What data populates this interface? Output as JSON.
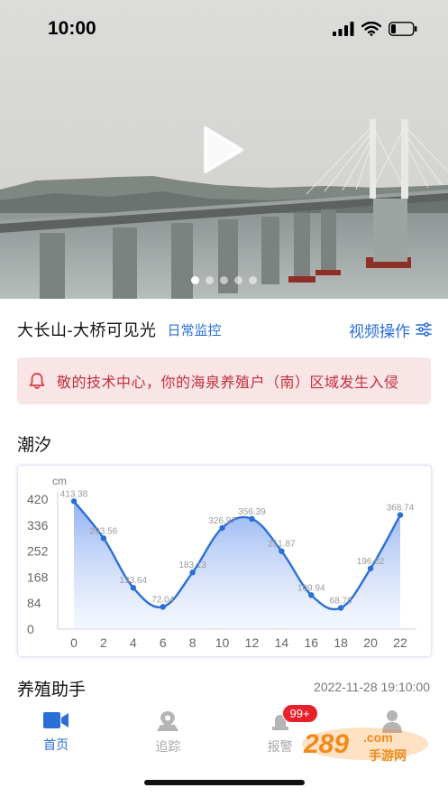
{
  "status": {
    "time": "10:00"
  },
  "hero": {
    "slides": 5,
    "active_slide": 0
  },
  "camera": {
    "title": "大长山-大桥可见光",
    "tag": "日常监控",
    "ops_label": "视频操作"
  },
  "alert": {
    "text": "敬的技术中心，你的海泉养殖户（南）区域发生入侵"
  },
  "tide": {
    "title": "潮汐"
  },
  "assistant": {
    "title": "养殖助手",
    "timestamp": "2022-11-28 19:10:00"
  },
  "tabs": [
    {
      "label": "首页",
      "icon": "video-camera-icon",
      "active": true
    },
    {
      "label": "追踪",
      "icon": "map-pin-icon",
      "active": false
    },
    {
      "label": "报警",
      "icon": "alarm-icon",
      "active": false,
      "badge": "99+"
    },
    {
      "label": "",
      "icon": "person-icon",
      "active": false
    }
  ],
  "watermark": {
    "text": "289 .com 手游网"
  },
  "colors": {
    "accent": "#2a6fd6",
    "alert_bg": "#f9e4e6",
    "alert_text": "#c2303c",
    "badge": "#e8202a"
  },
  "chart_data": {
    "type": "area",
    "title": "",
    "xlabel": "",
    "ylabel": "cm",
    "x": [
      0,
      2,
      4,
      6,
      8,
      10,
      12,
      14,
      16,
      18,
      20,
      22
    ],
    "series": [
      {
        "values": [
          413.38,
          293.56,
          133.64,
          72.04,
          183.13,
          326.97,
          356.39,
          251.87,
          109.94,
          68.76,
          196.02,
          368.74
        ]
      }
    ],
    "value_labels": [
      "413.38",
      "293.56",
      "133.64",
      "72.04",
      "183.13",
      "326.97",
      "356.39",
      "251.87",
      "109.94",
      "68.76",
      "196.02",
      "368.74"
    ],
    "x_ticks": [
      "0",
      "2",
      "4",
      "6",
      "8",
      "10",
      "12",
      "14",
      "16",
      "18",
      "20",
      "22"
    ],
    "y_ticks": [
      "0",
      "84",
      "168",
      "252",
      "336",
      "420"
    ],
    "ylim": [
      0,
      420
    ],
    "xlim": [
      0,
      22
    ],
    "grid": false,
    "line_color": "#2a6fd6"
  }
}
